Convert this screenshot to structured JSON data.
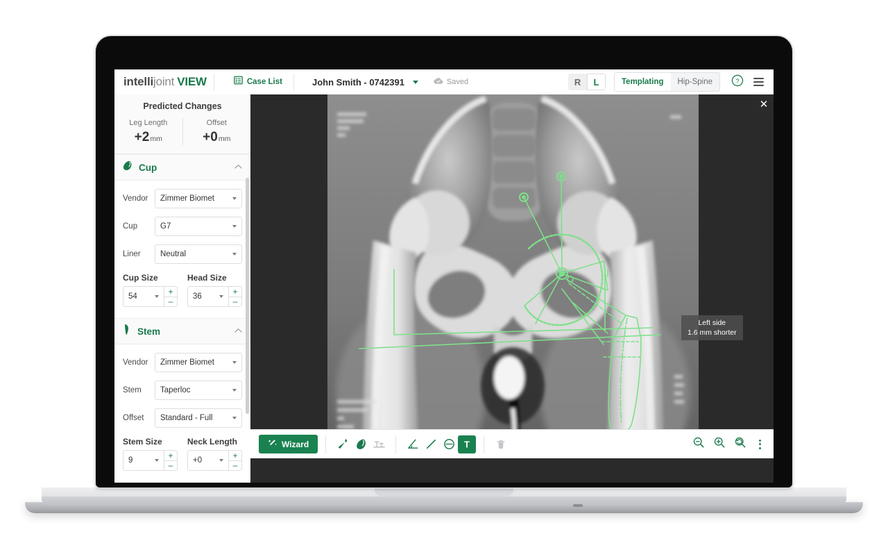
{
  "app": {
    "logo_part1": "intelli",
    "logo_part2": "joint",
    "logo_part3": "VIEW",
    "case_list_label": "Case List",
    "patient": "John Smith - 0742391",
    "saved_label": "Saved",
    "side_toggle": {
      "right": "R",
      "left": "L",
      "selected": "L"
    },
    "mode_tabs": [
      {
        "label": "Templating",
        "active": true
      },
      {
        "label": "Hip-Spine",
        "active": false
      }
    ],
    "help_label": "?",
    "accent_green": "#1a7a4c",
    "toolbar_green": "#1a8250",
    "overlay_green": "#7ee08a"
  },
  "predicted_changes": {
    "title": "Predicted Changes",
    "metrics": [
      {
        "label": "Leg Length",
        "value": "+2",
        "unit": "mm"
      },
      {
        "label": "Offset",
        "value": "+0",
        "unit": "mm"
      }
    ]
  },
  "cup_section": {
    "title": "Cup",
    "collapse_icon": "chevron-up",
    "fields": [
      {
        "label": "Vendor",
        "value": "Zimmer Biomet"
      },
      {
        "label": "Cup",
        "value": "G7"
      },
      {
        "label": "Liner",
        "value": "Neutral"
      }
    ],
    "sizes": [
      {
        "label": "Cup Size",
        "value": "54",
        "plus": "+",
        "minus": "–"
      },
      {
        "label": "Head Size",
        "value": "36",
        "plus": "+",
        "minus": "–"
      }
    ]
  },
  "stem_section": {
    "title": "Stem",
    "collapse_icon": "chevron-up",
    "fields": [
      {
        "label": "Vendor",
        "value": "Zimmer Biomet"
      },
      {
        "label": "Stem",
        "value": "Taperloc"
      },
      {
        "label": "Offset",
        "value": "Standard - Full"
      }
    ],
    "sizes": [
      {
        "label": "Stem Size",
        "value": "9",
        "plus": "+",
        "minus": "–"
      },
      {
        "label": "Neck Length",
        "value": "+0",
        "plus": "+",
        "minus": "–"
      }
    ]
  },
  "viewer": {
    "close_label": "✕",
    "measurement_tooltip": {
      "line1": "Left side",
      "line2": "1.6 mm shorter"
    }
  },
  "toolbar": {
    "wizard_label": "Wizard",
    "tools": [
      {
        "name": "stem-tool",
        "active": false,
        "enabled": true
      },
      {
        "name": "cup-tool",
        "active": false,
        "enabled": true
      },
      {
        "name": "leg-length-tool",
        "active": false,
        "enabled": false
      },
      {
        "name": "angle-tool",
        "active": false,
        "enabled": true
      },
      {
        "name": "line-tool",
        "active": false,
        "enabled": true
      },
      {
        "name": "circle-tool",
        "active": false,
        "enabled": true
      },
      {
        "name": "text-tool",
        "active": true,
        "enabled": true
      },
      {
        "name": "delete-tool",
        "active": false,
        "enabled": false
      }
    ],
    "zoom_out_label": "zoom-out",
    "zoom_in_label": "zoom-in",
    "zoom_reset_label": "zoom-reset",
    "more_label": "more-options"
  }
}
